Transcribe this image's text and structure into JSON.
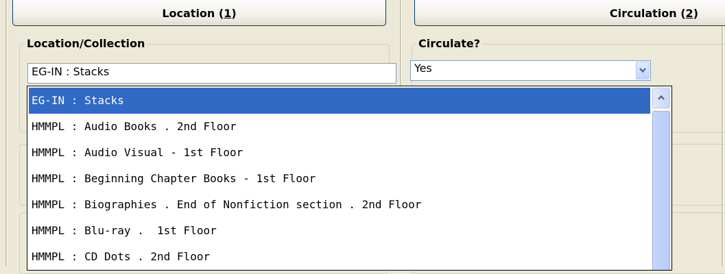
{
  "columns": {
    "location": {
      "label": "Location (",
      "accel": "1",
      "suffix": ")"
    },
    "circulation": {
      "label": "Circulation (",
      "accel": "2",
      "suffix": ")"
    }
  },
  "location_group": {
    "title": "Location/Collection",
    "value": "EG-IN : Stacks"
  },
  "circulate_group": {
    "title": "Circulate?",
    "value": "Yes"
  },
  "dropdown": {
    "selected_index": 0,
    "items": [
      "EG-IN : Stacks",
      "HMMPL : Audio Books . 2nd Floor",
      "HMMPL : Audio Visual - 1st Floor",
      "HMMPL : Beginning Chapter Books - 1st Floor",
      "HMMPL : Biographies . End of Nonfiction section . 2nd Floor",
      "HMMPL : Blu-ray .  1st Floor",
      "HMMPL : CD Dots . 2nd Floor"
    ]
  },
  "icons": {
    "combo_arrow": "chevron-down-icon",
    "scroll_up": "chevron-up-icon"
  },
  "colors": {
    "selection": "#316ac5",
    "background": "#ece9d8",
    "border": "#7f9db9"
  }
}
